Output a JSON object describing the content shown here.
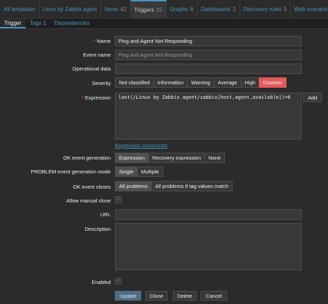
{
  "breadcrumbs": [
    {
      "label": "All templates",
      "count": ""
    },
    {
      "label": "Linux by Zabbix agent",
      "count": ""
    },
    {
      "label": "Items",
      "count": "42"
    },
    {
      "label": "Triggers",
      "count": "15"
    },
    {
      "label": "Graphs",
      "count": "8"
    },
    {
      "label": "Dashboards",
      "count": "2"
    },
    {
      "label": "Discovery rules",
      "count": "3"
    },
    {
      "label": "Web scenarios",
      "count": ""
    }
  ],
  "tabs": [
    {
      "label": "Trigger",
      "count": ""
    },
    {
      "label": "Tags",
      "count": "1"
    },
    {
      "label": "Dependencies",
      "count": ""
    }
  ],
  "form": {
    "name_label": "Name",
    "name_value": "Ping and Agent Not Responding",
    "event_name_label": "Event name",
    "event_name_placeholder": "Ping and Agent Not Responding",
    "operational_data_label": "Operational data",
    "operational_data_value": "",
    "severity_label": "Severity",
    "severity_options": [
      "Not classified",
      "Information",
      "Warning",
      "Average",
      "High",
      "Disaster"
    ],
    "expression_label": "Expression",
    "expression_value": "last(/Linux by Zabbix agent/zabbix[host,agent,available])=0",
    "add_button": "Add",
    "expression_constructor": "Expression constructor",
    "ok_event_generation_label": "OK event generation",
    "ok_event_generation_options": [
      "Expression",
      "Recovery expression",
      "None"
    ],
    "problem_mode_label": "PROBLEM event generation mode",
    "problem_mode_options": [
      "Single",
      "Multiple"
    ],
    "ok_event_closes_label": "OK event closes",
    "ok_event_closes_options": [
      "All problems",
      "All problems if tag values match"
    ],
    "allow_manual_close_label": "Allow manual close",
    "url_label": "URL",
    "url_value": "",
    "description_label": "Description",
    "description_value": "",
    "enabled_label": "Enabled",
    "checkmark": "✓"
  },
  "actions": {
    "update": "Update",
    "clone": "Clone",
    "delete": "Delete",
    "cancel": "Cancel"
  },
  "colors": {
    "accent": "#4796c4",
    "disaster": "#e45959",
    "background": "#2b2b2b"
  }
}
